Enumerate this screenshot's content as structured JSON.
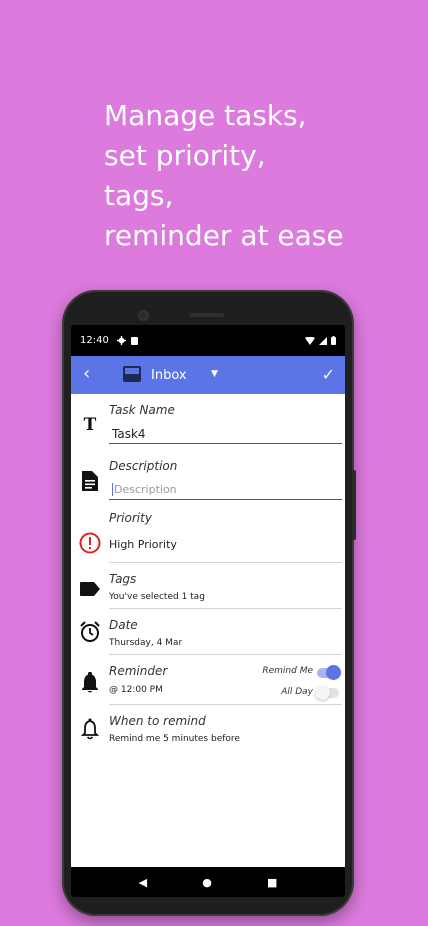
{
  "headline": [
    "Manage tasks,",
    "set priority,",
    "tags,",
    "reminder at ease"
  ],
  "status_bar": {
    "time": "12:40"
  },
  "app_bar": {
    "back_icon": "chevron-left-icon",
    "list_name": "Inbox",
    "confirm_icon": "check-icon",
    "accent": "#5b74e6"
  },
  "fields": {
    "task_name": {
      "label": "Task Name",
      "value": "Task4"
    },
    "description": {
      "label": "Description",
      "placeholder": "Description"
    },
    "priority": {
      "label": "Priority",
      "value": "High Priority",
      "color": "#e02323"
    },
    "tags": {
      "label": "Tags",
      "value": "You've selected 1 tag"
    },
    "date": {
      "label": "Date",
      "value": "Thursday, 4 Mar"
    },
    "reminder": {
      "label": "Reminder",
      "value": "@ 12:00 PM",
      "remind_me_label": "Remind Me",
      "remind_me_on": true,
      "all_day_label": "All Day",
      "all_day_on": false
    },
    "when_to_remind": {
      "label": "When to remind",
      "value": "Remind me 5 minutes before"
    }
  },
  "nav": {
    "back": "back-icon",
    "home": "home-icon",
    "recents": "recents-icon"
  }
}
